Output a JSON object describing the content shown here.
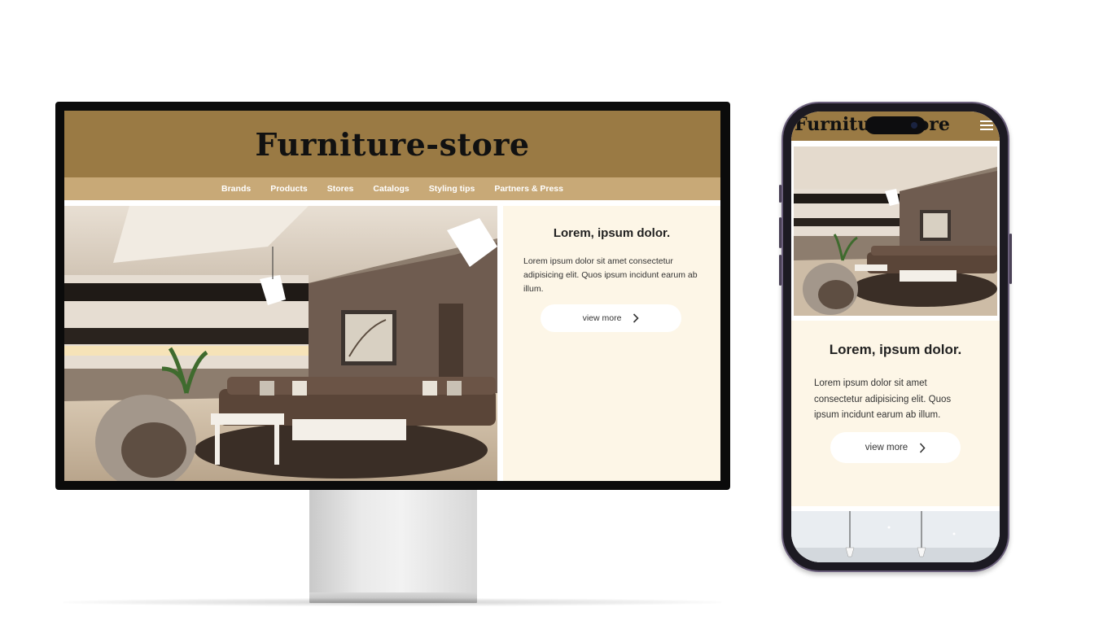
{
  "site": {
    "title": "Furniture-store"
  },
  "nav": {
    "items": [
      {
        "label": "Brands"
      },
      {
        "label": "Products"
      },
      {
        "label": "Stores"
      },
      {
        "label": "Catalogs"
      },
      {
        "label": "Styling tips"
      },
      {
        "label": "Partners & Press"
      }
    ]
  },
  "hero": {
    "heading": "Lorem, ipsum dolor.",
    "body": "Lorem ipsum dolor sit amet consectetur adipisicing elit. Quos ipsum incidunt earum ab illum.",
    "button_label": "view more",
    "image_icon": "living-room-photo"
  },
  "colors": {
    "header_bg": "#9a7a44",
    "nav_bg": "#c8a977",
    "card_bg": "#fdf6e7",
    "title_text": "#111111"
  },
  "icons": {
    "menu": "hamburger-menu-icon",
    "button_arrow": "chevron-right-icon"
  }
}
